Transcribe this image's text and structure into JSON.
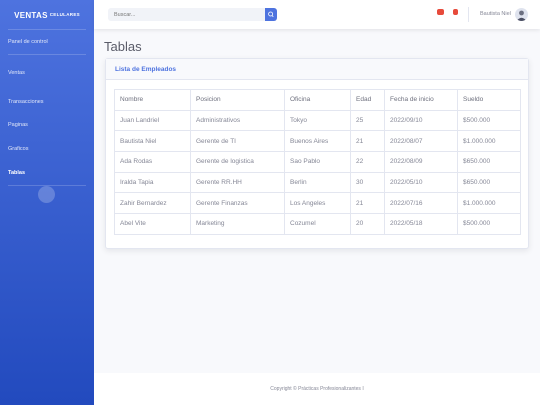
{
  "sidebar": {
    "brand": "VENTAS",
    "brand_sup": "CELULARES",
    "items": [
      {
        "label": "Panel de control",
        "active": false
      },
      {
        "label": "Ventas",
        "active": false
      },
      {
        "label": "Transacciones",
        "active": false
      },
      {
        "label": "Paginas",
        "active": false
      },
      {
        "label": "Graficos",
        "active": false
      },
      {
        "label": "Tablas",
        "active": true
      }
    ]
  },
  "topbar": {
    "search_placeholder": "Buscar...",
    "user_name": "Bautista Niel"
  },
  "page": {
    "title": "Tablas"
  },
  "card": {
    "title": "Lista de Empleados"
  },
  "table": {
    "headers": [
      "Nombre",
      "Posicion",
      "Oficina",
      "Edad",
      "Fecha de inicio",
      "Sueldo"
    ],
    "rows": [
      [
        "Juan Landriel",
        "Administrativos",
        "Tokyo",
        "25",
        "2022/09/10",
        "$500.000"
      ],
      [
        "Bautista Niel",
        "Gerente de TI",
        "Buenos Aires",
        "21",
        "2022/08/07",
        "$1.000.000"
      ],
      [
        "Ada Rodas",
        "Gerente de logistica",
        "Sao Pablo",
        "22",
        "2022/08/09",
        "$650.000"
      ],
      [
        "Iralda Tapia",
        "Gerente RR.HH",
        "Berlin",
        "30",
        "2022/05/10",
        "$650.000"
      ],
      [
        "Zahir Bernardez",
        "Gerente Finanzas",
        "Los Angeles",
        "21",
        "2022/07/16",
        "$1.000.000"
      ],
      [
        "Abel Vite",
        "Marketing",
        "Cozumel",
        "20",
        "2022/05/18",
        "$500.000"
      ]
    ]
  },
  "footer": {
    "text": "Copyright © Prácticas Profesionalizantes I"
  },
  "colors": {
    "primary": "#4e73df",
    "sidebar_dark": "#224abe",
    "danger": "#e74a3b"
  }
}
